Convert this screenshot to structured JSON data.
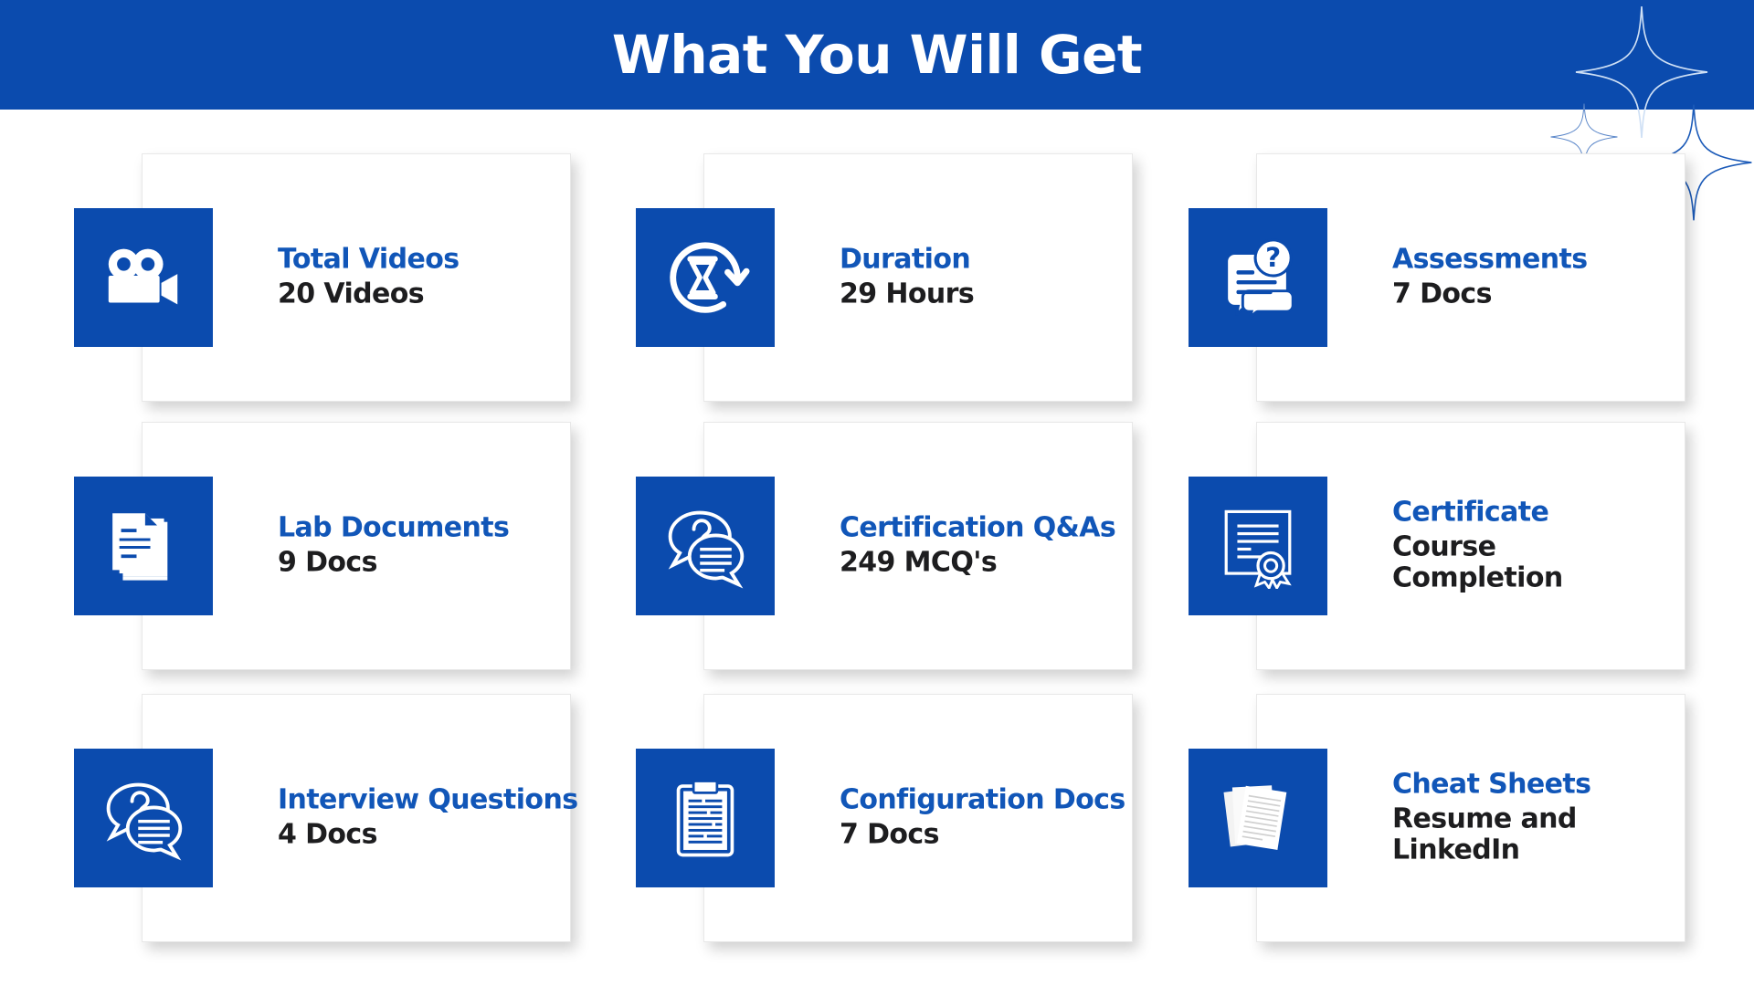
{
  "header": {
    "title": "What You Will Get",
    "background_color": "#0B4BAE",
    "title_color": "#ffffff"
  },
  "theme": {
    "brand_blue": "#0B4BAE",
    "title_blue": "#1156B8",
    "value_dark": "#1d1d1f",
    "card_background": "#ffffff",
    "card_border": "#e8e8e8"
  },
  "decorations": [
    {
      "name": "sparkle-large"
    },
    {
      "name": "sparkle-medium"
    },
    {
      "name": "sparkle-small"
    }
  ],
  "cards": [
    {
      "icon": "video-camera-icon",
      "title": "Total Videos",
      "value": "20 Videos"
    },
    {
      "icon": "hourglass-clock-icon",
      "title": "Duration",
      "value": "29 Hours"
    },
    {
      "icon": "question-message-icon",
      "title": "Assessments",
      "value": "7 Docs"
    },
    {
      "icon": "stacked-documents-icon",
      "title": "Lab Documents",
      "value": "9 Docs"
    },
    {
      "icon": "chat-bubbles-question-icon",
      "title": "Certification Q&As",
      "value": "249 MCQ's"
    },
    {
      "icon": "certificate-ribbon-icon",
      "title": "Certificate",
      "value": "Course Completion"
    },
    {
      "icon": "chat-bubbles-question-icon",
      "title": "Interview Questions",
      "value": "4 Docs"
    },
    {
      "icon": "clipboard-icon",
      "title": "Configuration Docs",
      "value": "7 Docs"
    },
    {
      "icon": "paper-sheets-icon",
      "title": "Cheat Sheets",
      "value": "Resume and\nLinkedIn"
    }
  ]
}
